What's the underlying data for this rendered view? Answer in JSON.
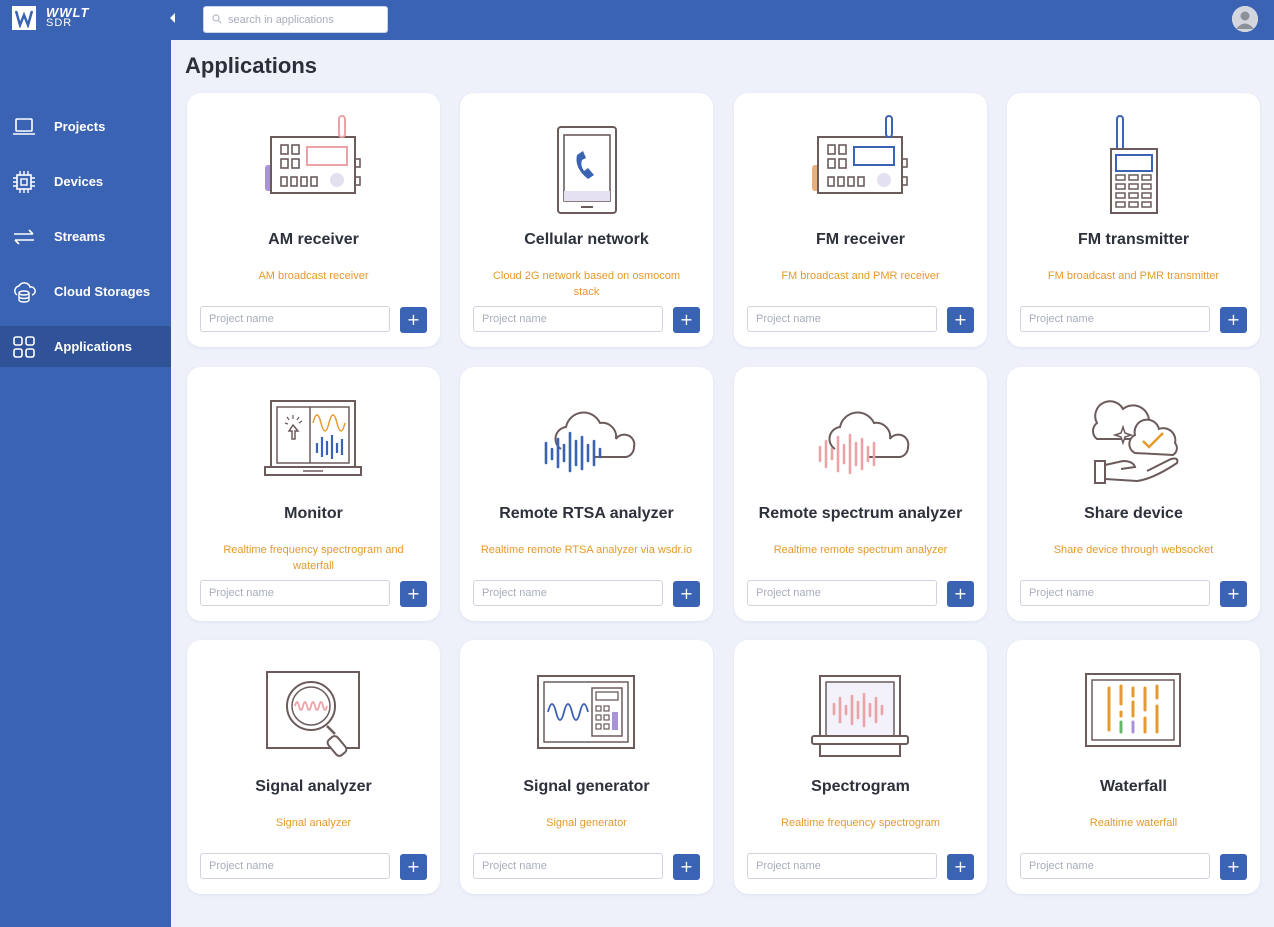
{
  "app": {
    "logo_line1": "WWLT",
    "logo_line2": "SDR"
  },
  "search": {
    "placeholder": "search in applications"
  },
  "sidebar": {
    "items": [
      {
        "label": "Projects",
        "icon": "laptop-icon"
      },
      {
        "label": "Devices",
        "icon": "chip-icon"
      },
      {
        "label": "Streams",
        "icon": "arrows-exchange-icon"
      },
      {
        "label": "Cloud Storages",
        "icon": "cloud-database-icon"
      },
      {
        "label": "Applications",
        "icon": "grid-icon",
        "active": true
      }
    ]
  },
  "main": {
    "title": "Applications",
    "project_placeholder": "Project name",
    "add_label": "+",
    "cards": [
      {
        "title": "AM receiver",
        "desc": "AM broadcast receiver",
        "icon": "am-radio-icon"
      },
      {
        "title": "Cellular network",
        "desc": "Cloud 2G network based on osmocom stack",
        "icon": "phone-icon"
      },
      {
        "title": "FM receiver",
        "desc": "FM broadcast and PMR receiver",
        "icon": "fm-radio-icon"
      },
      {
        "title": "FM transmitter",
        "desc": "FM broadcast and PMR transmitter",
        "icon": "walkie-talkie-icon"
      },
      {
        "title": "Monitor",
        "desc": "Realtime frequency spectrogram and waterfall",
        "icon": "monitor-laptop-icon"
      },
      {
        "title": "Remote RTSA analyzer",
        "desc": "Realtime remote RTSA analyzer via wsdr.io",
        "icon": "cloud-signal-blue-icon"
      },
      {
        "title": "Remote spectrum analyzer",
        "desc": "Realtime remote spectrum analyzer",
        "icon": "cloud-signal-pink-icon"
      },
      {
        "title": "Share device",
        "desc": "Share device through websocket",
        "icon": "share-cloud-hand-icon"
      },
      {
        "title": "Signal analyzer",
        "desc": "Signal analyzer",
        "icon": "magnifier-signal-icon"
      },
      {
        "title": "Signal generator",
        "desc": "Signal generator",
        "icon": "signal-generator-icon"
      },
      {
        "title": "Spectrogram",
        "desc": "Realtime frequency spectrogram",
        "icon": "spectrogram-laptop-icon"
      },
      {
        "title": "Waterfall",
        "desc": "Realtime waterfall",
        "icon": "waterfall-icon"
      }
    ]
  },
  "colors": {
    "brand": "#3b63b3",
    "accent": "#e49a2c",
    "active_nav": "#2f5299",
    "background": "#eef1fa"
  }
}
